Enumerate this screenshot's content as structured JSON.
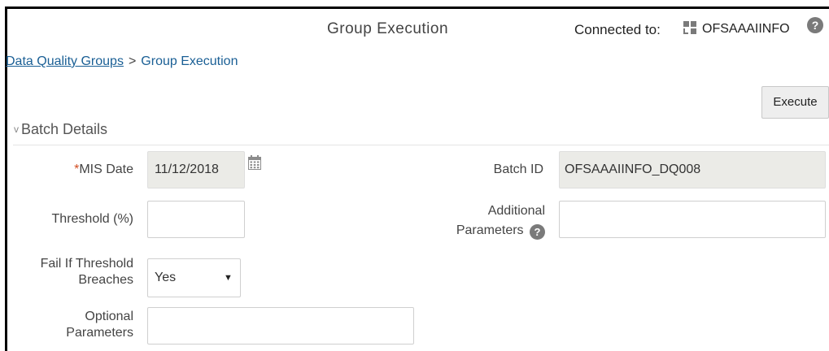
{
  "header": {
    "title": "Group Execution",
    "connected_label": "Connected to:",
    "connection_name": "OFSAAAIINFO",
    "help_glyph": "?"
  },
  "breadcrumb": {
    "parent": "Data Quality Groups",
    "separator": ">",
    "current": "Group Execution"
  },
  "toolbar": {
    "execute_label": "Execute"
  },
  "section": {
    "title": "Batch Details",
    "chevron": "v"
  },
  "form": {
    "mis_date": {
      "required_mark": "*",
      "label": "MIS Date",
      "value": "11/12/2018"
    },
    "threshold": {
      "label": "Threshold (%)",
      "value": ""
    },
    "fail_if_threshold": {
      "label_line1": "Fail If Threshold",
      "label_line2": "Breaches",
      "value": "Yes",
      "arrow": "▼"
    },
    "optional_parameters": {
      "label_line1": "Optional",
      "label_line2": "Parameters",
      "value": ""
    },
    "batch_id": {
      "label": "Batch ID",
      "value": "OFSAAAIINFO_DQ008"
    },
    "additional_parameters": {
      "label_line1": "Additional",
      "label_line2": "Parameters",
      "help_glyph": "?",
      "value": ""
    }
  },
  "colors": {
    "link": "#1a5f95",
    "required": "#d14c20",
    "readonly_field_bg": "#ebebe7",
    "help_icon_bg": "#7a7a7a"
  },
  "icons": {
    "connection": "grid-icon",
    "calendar": "calendar-icon",
    "help": "help-icon"
  }
}
